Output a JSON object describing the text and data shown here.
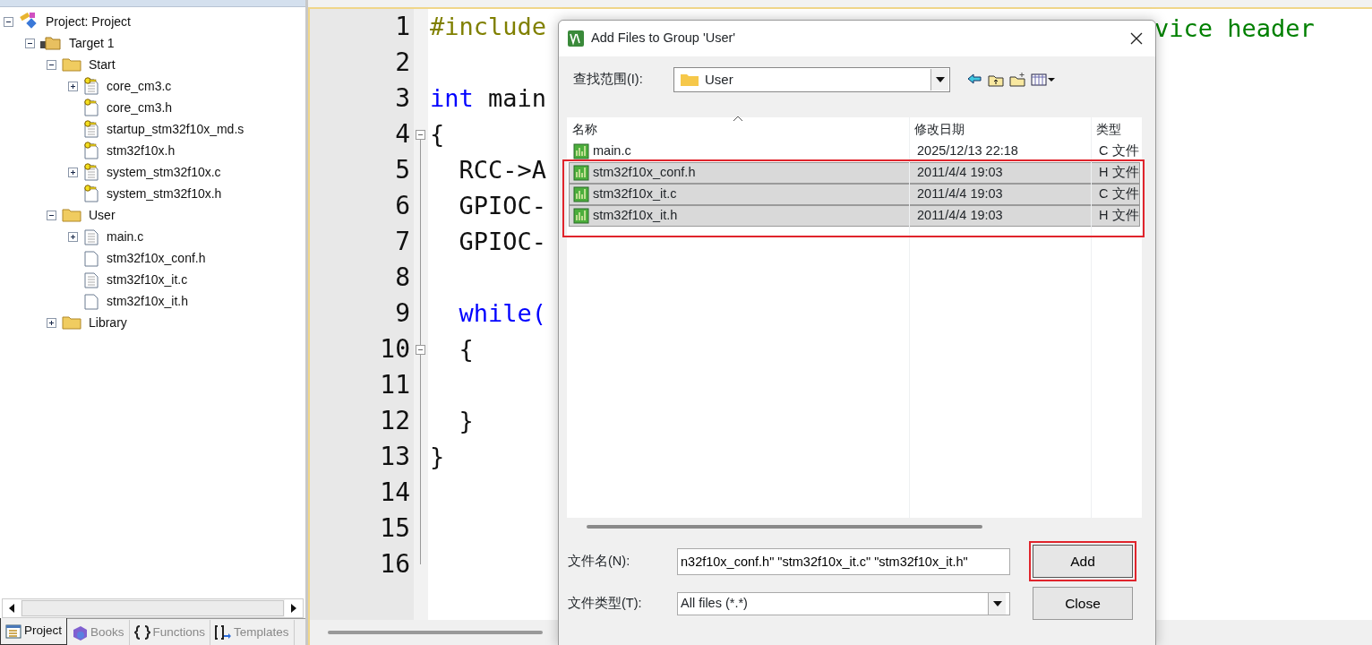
{
  "project_tree": [
    {
      "label": "Project: Project",
      "kind": "project",
      "expanded": true,
      "children": [
        {
          "label": "Target 1",
          "kind": "target",
          "expanded": true,
          "children": [
            {
              "label": "Start",
              "kind": "group",
              "expanded": true,
              "children": [
                {
                  "label": "core_cm3.c",
                  "kind": "source",
                  "locked": true,
                  "expanded": false
                },
                {
                  "label": "core_cm3.h",
                  "kind": "header",
                  "locked": true
                },
                {
                  "label": "startup_stm32f10x_md.s",
                  "kind": "source",
                  "locked": true
                },
                {
                  "label": "stm32f10x.h",
                  "kind": "header",
                  "locked": true
                },
                {
                  "label": "system_stm32f10x.c",
                  "kind": "source",
                  "locked": true,
                  "expanded": false
                },
                {
                  "label": "system_stm32f10x.h",
                  "kind": "header",
                  "locked": true
                }
              ]
            },
            {
              "label": "User",
              "kind": "group",
              "expanded": true,
              "children": [
                {
                  "label": "main.c",
                  "kind": "source",
                  "locked": false,
                  "expanded": false
                },
                {
                  "label": "stm32f10x_conf.h",
                  "kind": "header",
                  "locked": false
                },
                {
                  "label": "stm32f10x_it.c",
                  "kind": "source",
                  "locked": false
                },
                {
                  "label": "stm32f10x_it.h",
                  "kind": "header",
                  "locked": false
                }
              ]
            },
            {
              "label": "Library",
              "kind": "group",
              "expanded": false
            }
          ]
        }
      ]
    }
  ],
  "panel_tabs": [
    {
      "label": "Project",
      "kind": "project",
      "selected": true
    },
    {
      "label": "Books",
      "kind": "books",
      "selected": false
    },
    {
      "label": "Functions",
      "kind": "functions",
      "selected": false
    },
    {
      "label": "Templates",
      "kind": "templates",
      "selected": false
    }
  ],
  "editor": {
    "lines": [
      {
        "number": "1",
        "fold_start": false,
        "segments": [
          {
            "text": "#include",
            "kind": "directive"
          }
        ]
      },
      {
        "number": "2",
        "fold_start": false
      },
      {
        "number": "3",
        "fold_start": false,
        "segments": [
          {
            "text": "int",
            "kind": "keyword"
          },
          {
            "text": " main",
            "kind": "plain"
          }
        ]
      },
      {
        "number": "4",
        "fold_start": true,
        "segments": [
          {
            "text": "{",
            "kind": "plain"
          }
        ]
      },
      {
        "number": "5",
        "fold_start": false,
        "segments": [
          {
            "text": "  RCC->A",
            "kind": "plain"
          }
        ]
      },
      {
        "number": "6",
        "fold_start": false,
        "segments": [
          {
            "text": "  GPIOC-",
            "kind": "plain"
          }
        ]
      },
      {
        "number": "7",
        "fold_start": false,
        "segments": [
          {
            "text": "  GPIOC-",
            "kind": "plain"
          }
        ]
      },
      {
        "number": "8",
        "fold_start": false
      },
      {
        "number": "9",
        "fold_start": false,
        "segments": [
          {
            "text": "  while(",
            "kind": "keyword"
          }
        ]
      },
      {
        "number": "10",
        "fold_start": true,
        "segments": [
          {
            "text": "  {",
            "kind": "plain"
          }
        ]
      },
      {
        "number": "11",
        "fold_start": false
      },
      {
        "number": "12",
        "fold_start": false,
        "segments": [
          {
            "text": "  }",
            "kind": "plain"
          }
        ]
      },
      {
        "number": "13",
        "fold_start": false,
        "segments": [
          {
            "text": "}",
            "kind": "plain"
          }
        ]
      },
      {
        "number": "14",
        "fold_start": false
      },
      {
        "number": "15",
        "fold_start": false
      },
      {
        "number": "16",
        "fold_start": false
      }
    ],
    "comment_tail": "vice header"
  },
  "dialog": {
    "title": "Add Files to Group 'User'",
    "look_in": {
      "label": "查找范围(I):",
      "value": "User"
    },
    "columns": [
      "名称",
      "修改日期",
      "类型"
    ],
    "files": [
      {
        "name": "main.c",
        "date": "2025/12/13 22:18",
        "type": "C 文件",
        "selected": false
      },
      {
        "name": "stm32f10x_conf.h",
        "date": "2011/4/4 19:03",
        "type": "H 文件",
        "selected": true
      },
      {
        "name": "stm32f10x_it.c",
        "date": "2011/4/4 19:03",
        "type": "C 文件",
        "selected": true
      },
      {
        "name": "stm32f10x_it.h",
        "date": "2011/4/4 19:03",
        "type": "H 文件",
        "selected": true
      }
    ],
    "file_name": {
      "label": "文件名(N):",
      "value": "n32f10x_conf.h\" \"stm32f10x_it.c\" \"stm32f10x_it.h\""
    },
    "file_type": {
      "label": "文件类型(T):",
      "value": "All files (*.*)"
    },
    "buttons": [
      {
        "label": "Add",
        "highlighted": true
      },
      {
        "label": "Close",
        "highlighted": false
      }
    ]
  }
}
